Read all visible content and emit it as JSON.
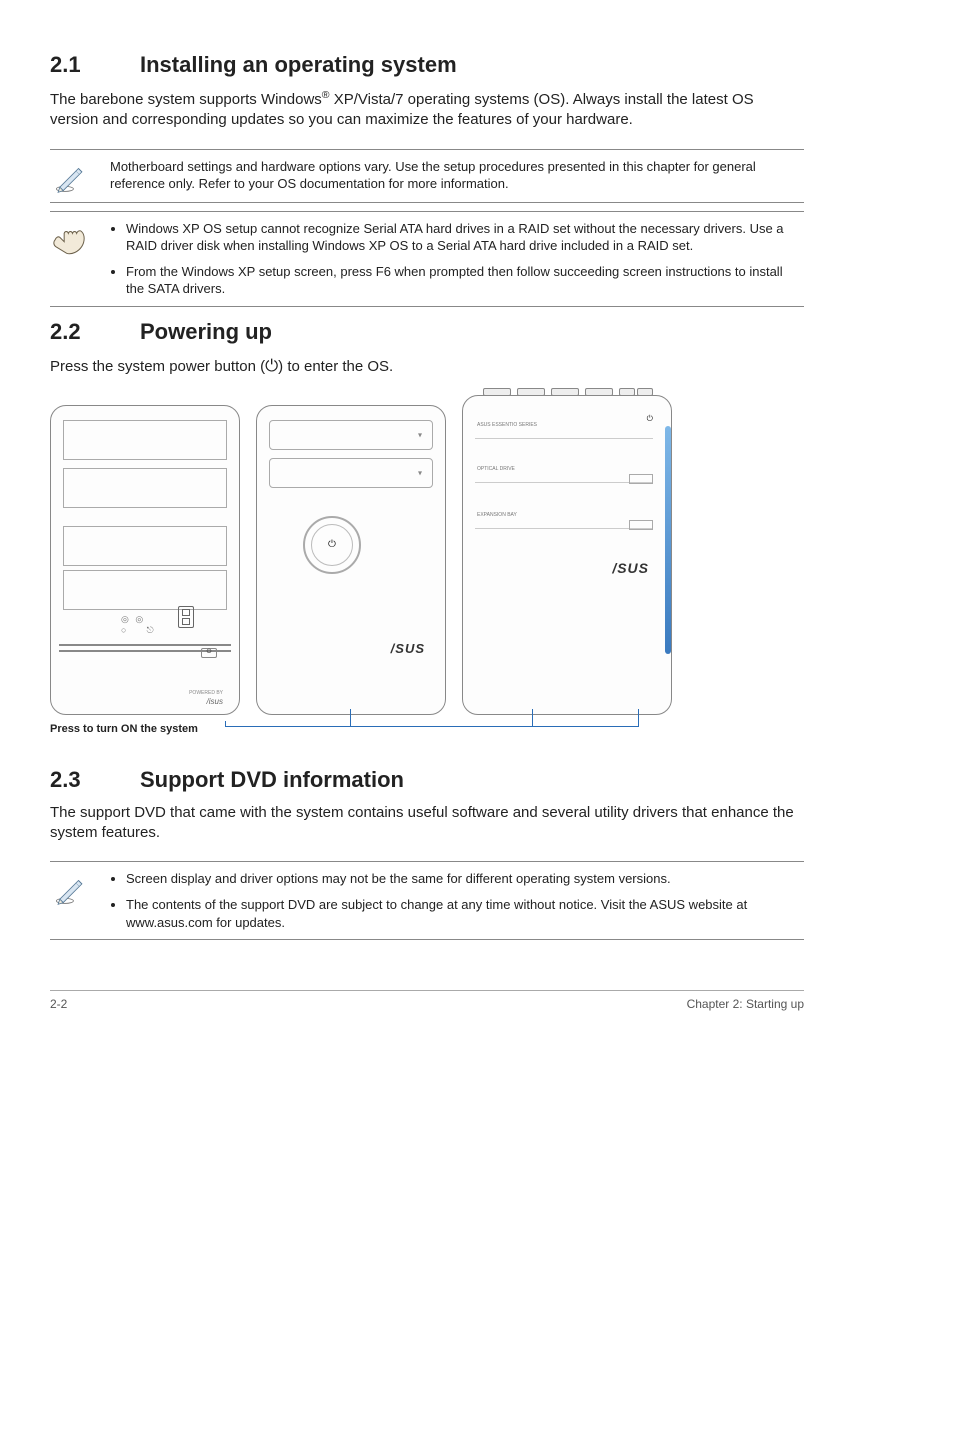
{
  "sections": {
    "s1": {
      "num": "2.1",
      "title": "Installing an operating system"
    },
    "s2": {
      "num": "2.2",
      "title": "Powering up"
    },
    "s3": {
      "num": "2.3",
      "title": "Support DVD information"
    }
  },
  "body": {
    "s1_p_pre": "The barebone system supports Windows",
    "s1_p_sup": "®",
    "s1_p_post": " XP/Vista/7 operating systems (OS). Always install the latest OS version and corresponding updates so you can maximize the features of your hardware.",
    "s2_p_pre": "Press the system power button (",
    "s2_p_post": ") to enter the OS.",
    "s3_p": "The support DVD that came with the system contains useful software and several utility drivers that enhance the system features."
  },
  "callouts": {
    "note1": "Motherboard settings and hardware options vary. Use the setup procedures presented in this chapter for general reference only. Refer to your OS documentation for more information.",
    "warn_li1": "Windows XP OS setup cannot recognize Serial ATA hard drives in a RAID set without the necessary drivers. Use a RAID driver disk when installing Windows XP OS to a Serial ATA hard drive included in a RAID set.",
    "warn_li2": "From the Windows XP setup screen, press F6 when prompted then follow succeeding screen instructions to install the SATA drivers.",
    "note2_li1": "Screen display and driver options may not be the same for different operating system versions.",
    "note2_li2": "The contents of the support DVD are subject to change at any time without notice. Visit the ASUS website at www.asus.com for updates."
  },
  "figure": {
    "caption": "Press to turn ON the system",
    "series_label": "ASUS ESSENTIO SERIES",
    "optical_label": "OPTICAL DRIVE",
    "expansion_label": "EXPANSION BAY",
    "brand_small": "/isus",
    "brand": "/SUS",
    "powered_by": "POWERED BY"
  },
  "footer": {
    "left": "2-2",
    "right": "Chapter 2: Starting up"
  }
}
